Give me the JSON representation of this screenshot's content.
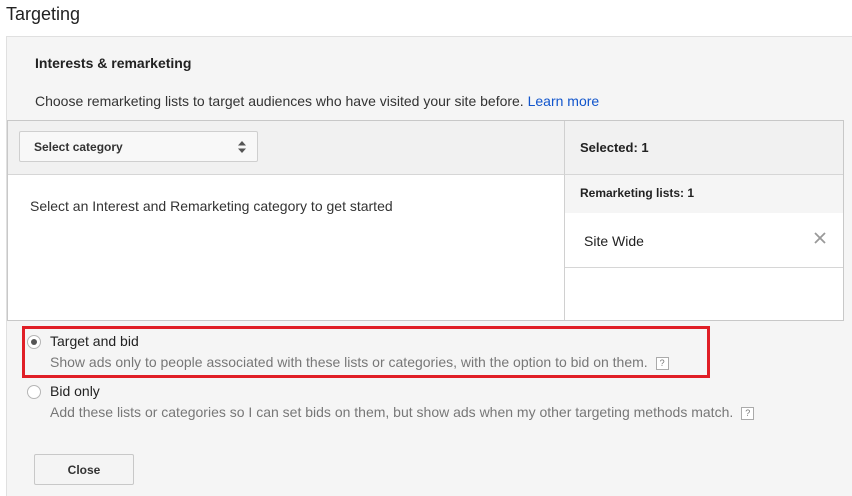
{
  "page": {
    "title": "Targeting"
  },
  "section": {
    "title": "Interests & remarketing",
    "description": "Choose remarketing lists to target audiences who have visited your site before.",
    "learn_more": "Learn more"
  },
  "picker": {
    "select_label": "Select category",
    "select_icon": "up-down-arrows-icon",
    "empty_hint": "Select an Interest and Remarketing category to get started",
    "selected_label": "Selected: 1",
    "group_label": "Remarketing lists: 1",
    "items": [
      {
        "label": "Site Wide",
        "remove_icon": "close-x-icon"
      }
    ]
  },
  "targeting_options": [
    {
      "label": "Target and bid",
      "description": "Show ads only to people associated with these lists or categories, with the option to bid on them.",
      "checked": true,
      "help": "?"
    },
    {
      "label": "Bid only",
      "description": "Add these lists or categories so I can set bids on them, but show ads when my other targeting methods match.",
      "checked": false,
      "help": "?"
    }
  ],
  "actions": {
    "close_label": "Close"
  },
  "colors": {
    "link": "#1155cc",
    "highlight": "#e01e26",
    "panel_bg": "#f5f5f5"
  }
}
